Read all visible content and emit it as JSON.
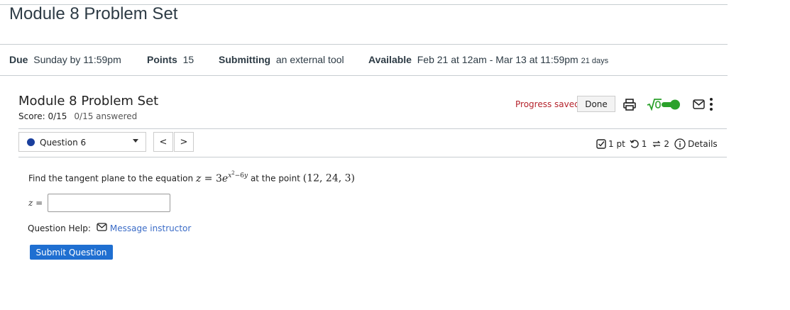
{
  "page": {
    "title": "Module 8 Problem Set"
  },
  "meta": {
    "due_label": "Due",
    "due_value": "Sunday by 11:59pm",
    "points_label": "Points",
    "points_value": "15",
    "submitting_label": "Submitting",
    "submitting_value": "an external tool",
    "available_label": "Available",
    "available_value": "Feb 21 at 12am - Mar 13 at 11:59pm",
    "available_days": "21 days"
  },
  "problem_set": {
    "title": "Module 8 Problem Set",
    "score": "Score: 0/15",
    "answered": "0/15 answered",
    "progress": "Progress saved",
    "done_label": "Done"
  },
  "question_nav": {
    "selected": "Question 6",
    "prev": "<",
    "next": ">"
  },
  "question_info": {
    "points": "1 pt",
    "retries": "1",
    "attempts": "2",
    "details": "Details"
  },
  "question": {
    "prefix": "Find the tangent plane to the equation",
    "suffix": "at the point",
    "point": "(12, 24, 3)",
    "answer_label": "z ="
  },
  "help": {
    "label": "Question Help:",
    "message": "Message instructor"
  },
  "submit_label": "Submit Question",
  "colors": {
    "accent": "#1f6fd1",
    "progress": "#b5232c",
    "toggle": "#2ba12b",
    "link": "#3b6cc7"
  },
  "icons": [
    "print-icon",
    "sqrt-icon",
    "toggle-switch",
    "mail-icon",
    "more-vertical-icon",
    "checkbox-icon",
    "retry-icon",
    "attempts-icon",
    "info-icon"
  ]
}
